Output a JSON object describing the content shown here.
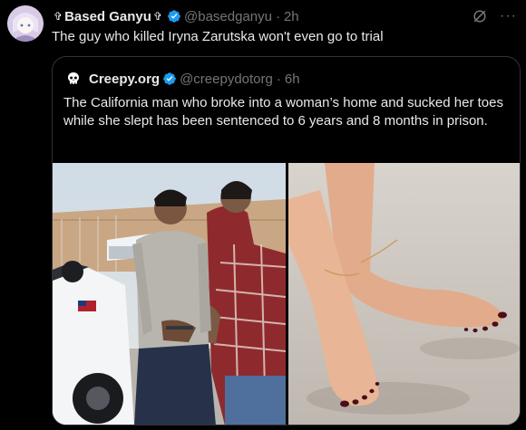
{
  "post": {
    "display_name": "Based Ganyu",
    "name_prefix": "✞",
    "name_suffix": "✞",
    "handle": "@basedganyu",
    "separator": "·",
    "time": "2h",
    "text": "The guy who killed Iryna Zarutska won't even go to trial",
    "more": "···"
  },
  "quote": {
    "display_name": "Creepy.org",
    "handle": "@creepydotorg",
    "separator": "·",
    "time": "6h",
    "text": "The California man who broke into a woman’s home and sucked her toes while she slept has been sentenced to 6 years and 8 months in prison."
  },
  "colors": {
    "background": "#000000",
    "text": "#e7e9ea",
    "muted": "#71767b",
    "border": "#2f3336",
    "verified": "#1d9bf0"
  },
  "icons": {
    "verified": "verified-badge-icon",
    "grok": "grok-icon",
    "more": "more-icon",
    "quote_avatar": "skull-icon"
  }
}
